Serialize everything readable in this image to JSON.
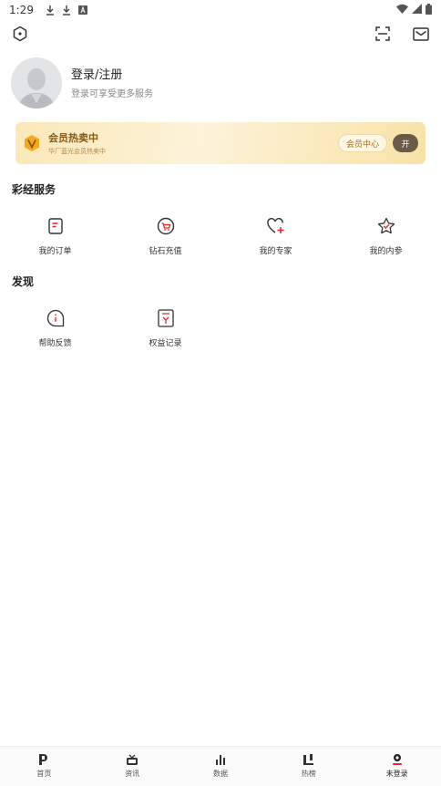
{
  "status_bar": {
    "time": "1:29",
    "left_icons": [
      "download-icon",
      "download-icon",
      "text-icon"
    ],
    "right_icons": [
      "wifi-icon",
      "signal-icon",
      "battery-icon"
    ]
  },
  "top_bar": {
    "left_icon": "hexagon-settings-icon",
    "right_icons": [
      "scan-icon",
      "mail-icon"
    ]
  },
  "profile": {
    "title": "登录/注册",
    "subtitle": "登录可享受更多服务"
  },
  "vip": {
    "badge": "V",
    "title": "会员热卖中",
    "subtitle": "华厂蓝光会员热卖中",
    "center_label": "会员中心",
    "open_label": "开"
  },
  "sections": {
    "lottery_services": {
      "title": "彩经服务",
      "items": [
        {
          "label": "我的订单",
          "icon": "order-icon"
        },
        {
          "label": "钻石充值",
          "icon": "diamond-cart-icon"
        },
        {
          "label": "我的专家",
          "icon": "heart-plus-icon"
        },
        {
          "label": "我的内参",
          "icon": "star-check-icon"
        }
      ]
    },
    "discover": {
      "title": "发现",
      "items": [
        {
          "label": "帮助反馈",
          "icon": "info-chat-icon"
        },
        {
          "label": "权益记录",
          "icon": "record-icon"
        }
      ]
    }
  },
  "tabs": [
    {
      "label": "首页",
      "icon": "home-icon"
    },
    {
      "label": "资讯",
      "icon": "tv-icon"
    },
    {
      "label": "数据",
      "icon": "bar-chart-icon"
    },
    {
      "label": "热榜",
      "icon": "hot-list-icon"
    },
    {
      "label": "未登录",
      "icon": "user-icon",
      "active": true
    }
  ],
  "colors": {
    "accent_red": "#e2272b",
    "vip_brown": "#8a5a14",
    "vip_button_dark": "#6b5a48"
  }
}
